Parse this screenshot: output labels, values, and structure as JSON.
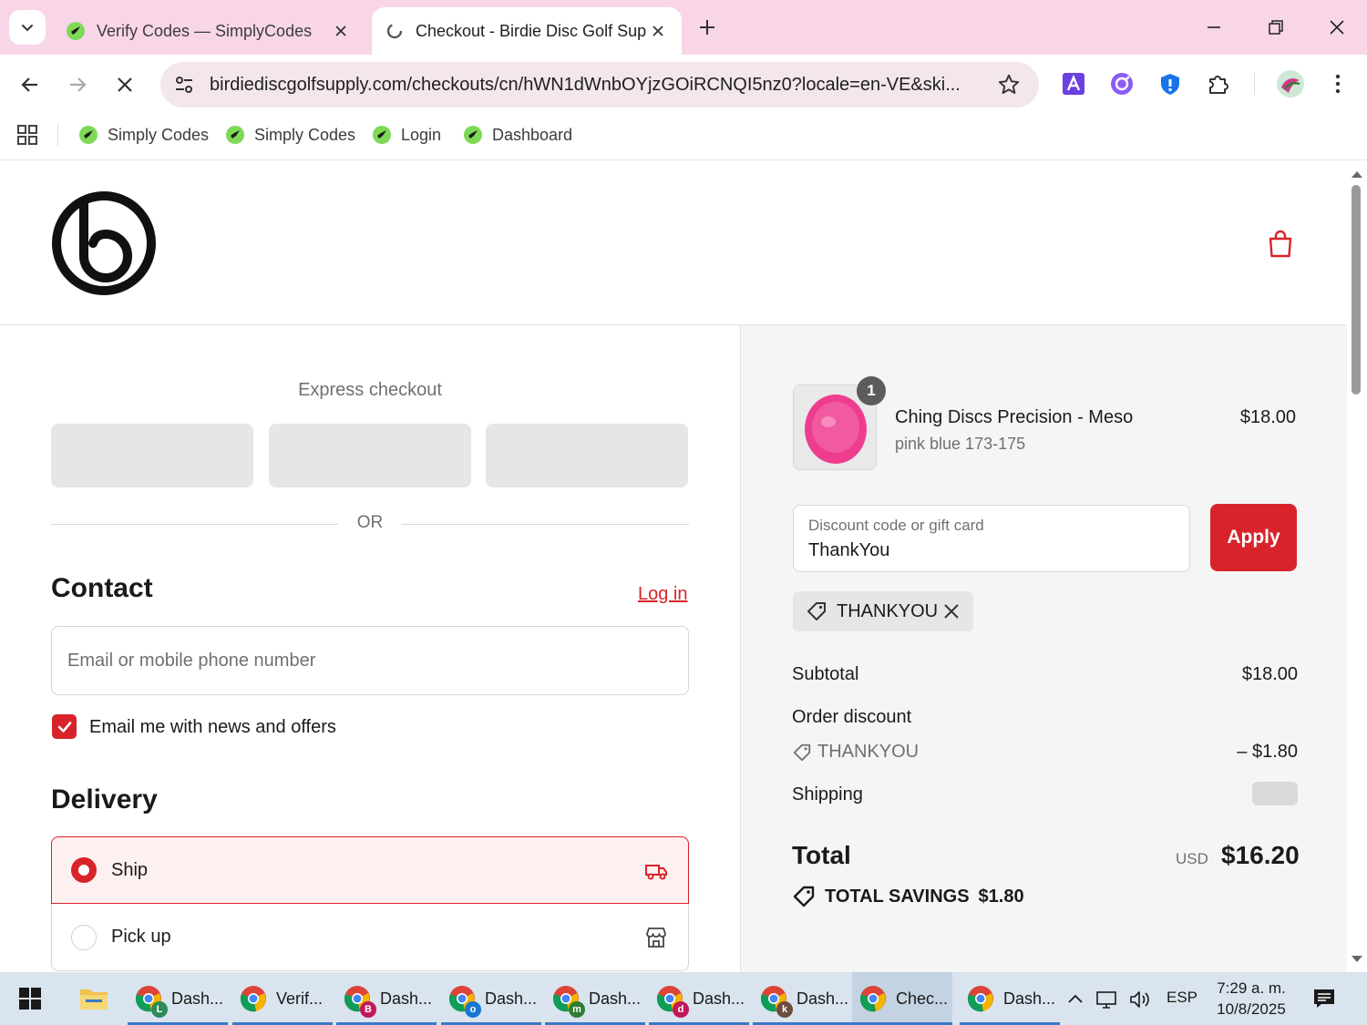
{
  "browser": {
    "tabs": [
      {
        "title": "Verify Codes — SimplyCodes",
        "active": false
      },
      {
        "title": "Checkout - Birdie Disc Golf Sup",
        "active": true
      }
    ],
    "url": "birdiediscgolfsupply.com/checkouts/cn/hWN1dWnbOYjzGOiRCNQI5nz0?locale=en-VE&ski...",
    "bookmarks": [
      "Simply Codes",
      "Simply Codes",
      "Login",
      "Dashboard"
    ],
    "icons": [
      "tab-search-icon",
      "close-icon",
      "new-tab-icon",
      "minimize-icon",
      "restore-icon",
      "back-icon",
      "forward-icon",
      "stop-icon",
      "site-settings-icon",
      "star-icon",
      "extension-icon",
      "menu-dots-icon",
      "apps-grid-icon"
    ]
  },
  "checkout": {
    "express_label": "Express checkout",
    "or_label": "OR",
    "contact_heading": "Contact",
    "login_link": "Log in",
    "email_placeholder": "Email or mobile phone number",
    "newsletter_label": "Email me with news and offers",
    "newsletter_checked": true,
    "delivery_heading": "Delivery",
    "delivery_options": [
      {
        "label": "Ship",
        "selected": true,
        "icon": "truck-icon"
      },
      {
        "label": "Pick up",
        "selected": false,
        "icon": "store-icon"
      }
    ]
  },
  "summary": {
    "item": {
      "quantity": "1",
      "name": "Ching Discs Precision - Meso",
      "variant": "pink blue 173-175",
      "price": "$18.00"
    },
    "discount_label": "Discount code or gift card",
    "discount_value": "ThankYou",
    "apply_label": "Apply",
    "applied_code": "THANKYOU",
    "subtotal_label": "Subtotal",
    "subtotal_value": "$18.00",
    "order_discount_label": "Order discount",
    "order_discount_code": "THANKYOU",
    "order_discount_value": "– $1.80",
    "shipping_label": "Shipping",
    "total_label": "Total",
    "total_currency": "USD",
    "total_value": "$16.20",
    "savings_label": "TOTAL SAVINGS",
    "savings_value": "$1.80"
  },
  "taskbar": {
    "items": [
      {
        "label": "Dash...",
        "badge": "L",
        "badge_color": "#2e8b57"
      },
      {
        "label": "Verif...",
        "badge": "",
        "badge_color": "#3fa34d"
      },
      {
        "label": "Dash...",
        "badge": "B",
        "badge_color": "#c2185b"
      },
      {
        "label": "Dash...",
        "badge": "o",
        "badge_color": "#1976d2"
      },
      {
        "label": "Dash...",
        "badge": "m",
        "badge_color": "#2e7d32"
      },
      {
        "label": "Dash...",
        "badge": "d",
        "badge_color": "#c2185b"
      },
      {
        "label": "Dash...",
        "badge": "k",
        "badge_color": "#6d4c41"
      },
      {
        "label": "Chec...",
        "badge": "",
        "badge_color": "#3fa34d"
      },
      {
        "label": "Dash...",
        "badge": "",
        "badge_color": "#3fa34d"
      }
    ],
    "language": "ESP",
    "time": "7:29 a. m.",
    "date": "10/8/2025"
  },
  "colors": {
    "accent": "#d8232a",
    "tabstrip": "#f8d6e8",
    "summary_bg": "#f5f5f5",
    "taskbar": "#d9e4ee"
  }
}
